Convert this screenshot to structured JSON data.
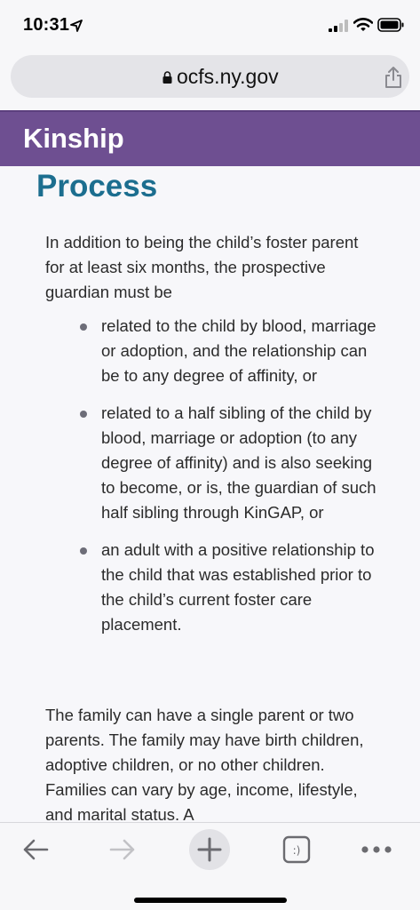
{
  "status_bar": {
    "time": "10:31"
  },
  "browser": {
    "url": "ocfs.ny.gov"
  },
  "site": {
    "header_title": "Kinship"
  },
  "content": {
    "heading": "Process",
    "intro": "In addition to being the child’s foster parent for at least six months, the prospective guardian must be",
    "bullets": [
      "related to the child by blood, marriage or adoption, and the relationship can be to any degree of affinity, or",
      "related to a half sibling of the child by blood, marriage or adoption (to any degree of affinity) and is also seeking to become, or is, the guardian of such half sibling through KinGAP, or",
      "an adult with a positive relationship to the child that was established prior to the child’s current foster care placement."
    ],
    "paragraph2": "The family can have a single parent or two parents. The family may have birth children, adoptive children, or no other children. Families can vary by age, income, lifestyle, and marital status. A"
  },
  "toolbar": {
    "tabs_glyph": ":)"
  },
  "colors": {
    "header_bg": "#6e4f91",
    "heading_text": "#1c6e8f",
    "content_bg": "#f7f7fa"
  }
}
